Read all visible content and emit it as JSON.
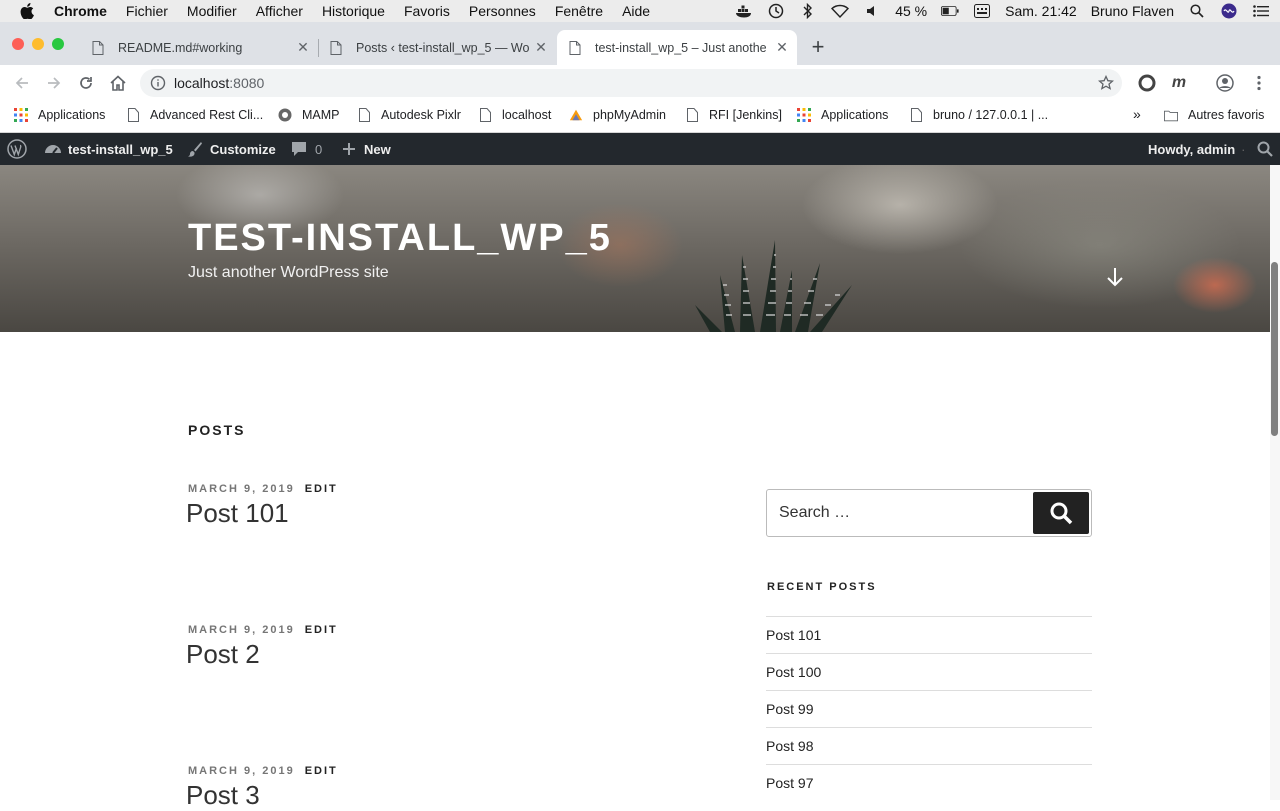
{
  "mac": {
    "app_name": "Chrome",
    "menus": [
      "Fichier",
      "Modifier",
      "Afficher",
      "Historique",
      "Favoris",
      "Personnes",
      "Fenêtre",
      "Aide"
    ],
    "battery": "45 %",
    "clock": "Sam. 21:42",
    "user": "Bruno Flaven"
  },
  "tabs": [
    {
      "title": "README.md#working"
    },
    {
      "title": "Posts ‹ test-install_wp_5 — Wo"
    },
    {
      "title": "test-install_wp_5 – Just anothe"
    }
  ],
  "address": {
    "host": "localhost",
    "port": ":8080"
  },
  "bookmarks": [
    {
      "label": "Applications",
      "icon": "apps-grid-icon"
    },
    {
      "label": "Advanced Rest Cli...",
      "icon": "page-icon"
    },
    {
      "label": "MAMP",
      "icon": "mamp-icon"
    },
    {
      "label": "Autodesk Pixlr",
      "icon": "page-icon"
    },
    {
      "label": "localhost",
      "icon": "page-icon"
    },
    {
      "label": "phpMyAdmin",
      "icon": "phpmyadmin-icon"
    },
    {
      "label": "RFI [Jenkins]",
      "icon": "page-icon"
    },
    {
      "label": "Applications",
      "icon": "apps-grid-icon"
    },
    {
      "label": "bruno / 127.0.0.1 | ...",
      "icon": "page-icon"
    }
  ],
  "bookmarks_more": "»",
  "other_bookmarks": "Autres favoris",
  "adminbar": {
    "site_name": "test-install_wp_5",
    "customize": "Customize",
    "comments_count": "0",
    "new": "New",
    "howdy": "Howdy, admin"
  },
  "header": {
    "site_title": "TEST-INSTALL_WP_5",
    "tagline": "Just another WordPress site"
  },
  "main": {
    "page_heading": "POSTS",
    "posts": [
      {
        "date": "MARCH 9, 2019",
        "edit": "EDIT",
        "title": "Post 101"
      },
      {
        "date": "MARCH 9, 2019",
        "edit": "EDIT",
        "title": "Post 2"
      },
      {
        "date": "MARCH 9, 2019",
        "edit": "EDIT",
        "title": "Post 3"
      }
    ]
  },
  "sidebar": {
    "search_placeholder": "Search …",
    "recent_title": "RECENT POSTS",
    "recent_posts": [
      "Post 101",
      "Post 100",
      "Post 99",
      "Post 98",
      "Post 97"
    ]
  }
}
